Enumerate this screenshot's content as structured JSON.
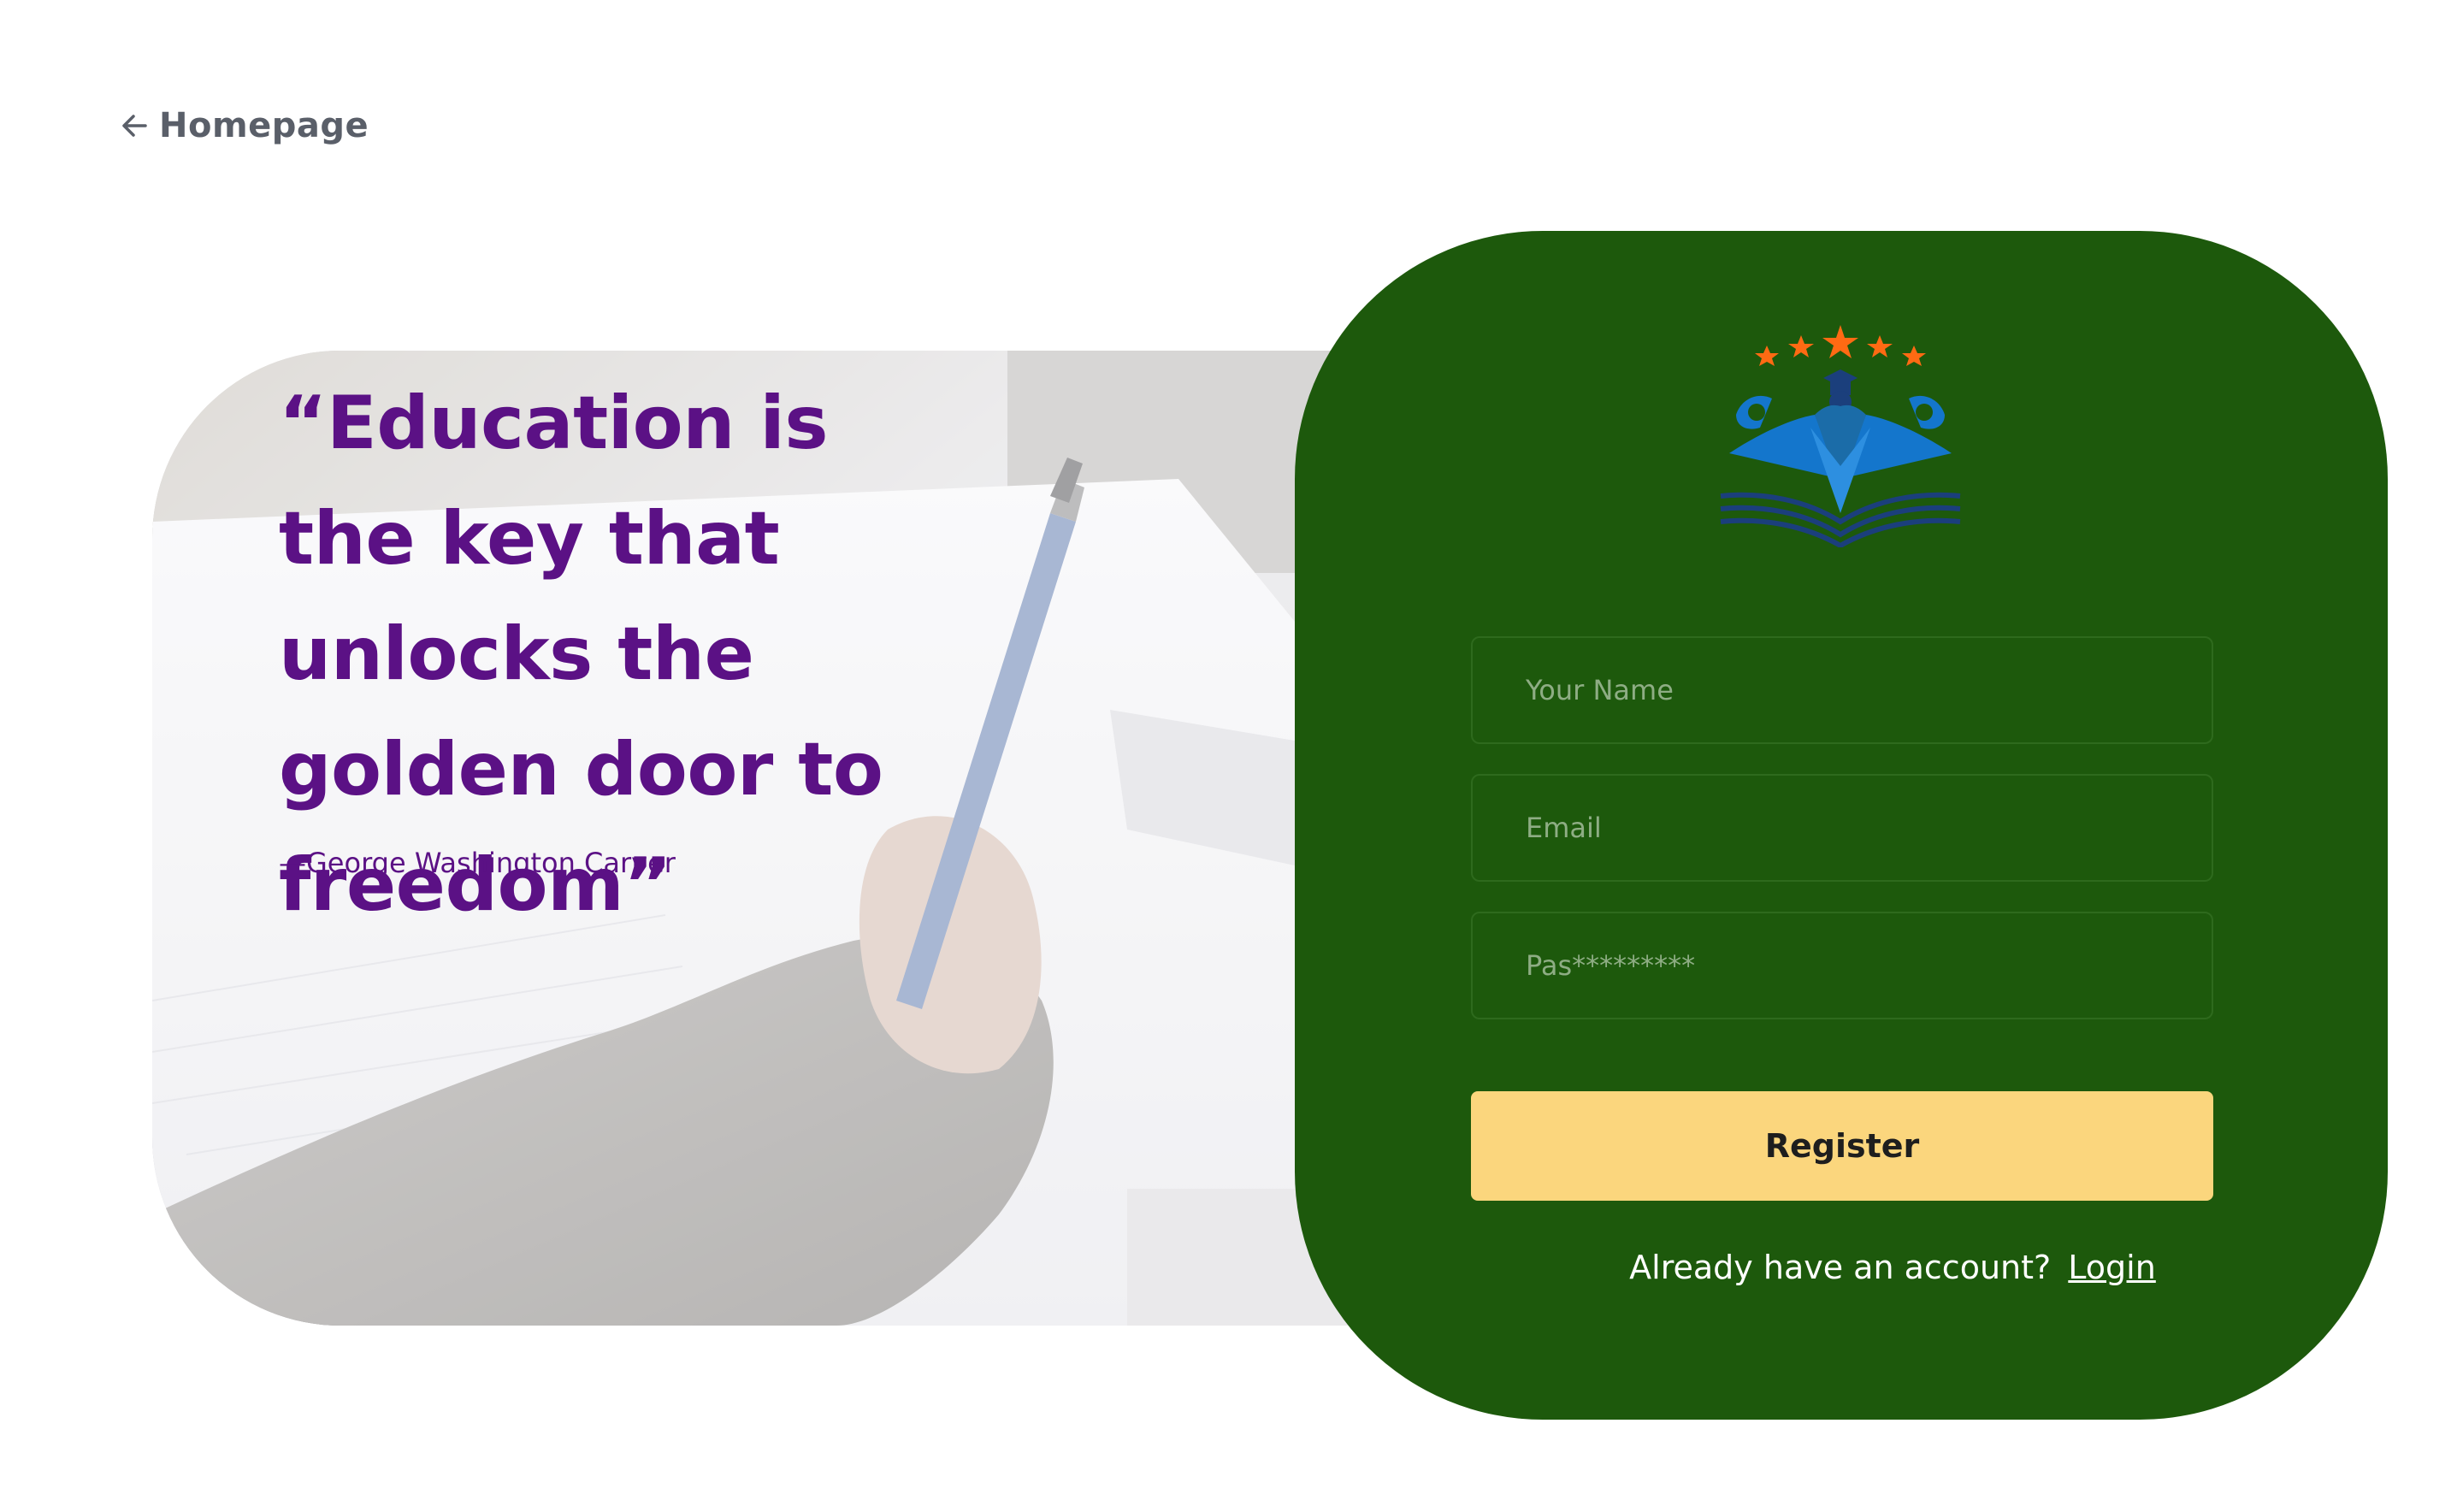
{
  "nav": {
    "back_label": "Homepage"
  },
  "quote": {
    "text": "“Education is the key that unlocks the golden door to freedom”",
    "author": "—George Washington Carver"
  },
  "form": {
    "name_placeholder": "Your Name",
    "email_placeholder": "Email",
    "password_placeholder": "Pas*********",
    "register_label": "Register",
    "login_prompt": "Already have an account?",
    "login_link": "Login"
  },
  "icons": {
    "back": "arrow-left-icon",
    "logo": "education-logo-icon"
  },
  "colors": {
    "card_bg": "#1d590c",
    "button_bg": "#fbd67d",
    "quote_text": "#5b1185",
    "back_link": "#5a5f69"
  }
}
